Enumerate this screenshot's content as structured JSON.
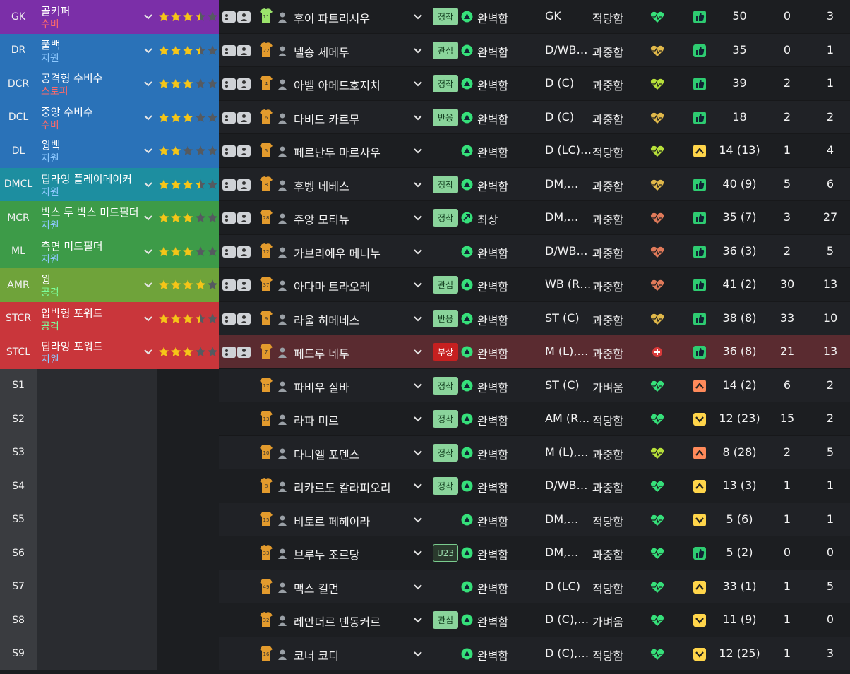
{
  "colors": {
    "gk": "#7b2fa8",
    "def": "#2a72b8",
    "dm": "#1d8ea0",
    "mid": "#3d9b48",
    "wing": "#6fa33a",
    "fwd": "#c9363b",
    "sub_pos": "#3a3c40",
    "sub_role": "#2a2c30",
    "duty_defend": "#ff6a6a",
    "duty_support": "#8ec9ff",
    "duty_attack": "#7cff9a",
    "star": "#f5c518",
    "star_empty": "#555a60",
    "heart_green": "#36e07a",
    "morale_green": "#2ecc71",
    "morale_yellow": "#ffd54a",
    "morale_orange": "#ff8a5a"
  },
  "rows": [
    {
      "pos": "GK",
      "role": "골키퍼",
      "duty": "수비",
      "duty_color": "#ff6a6a",
      "band": "#7b2fa8",
      "stars": 3.5,
      "kit": "11",
      "kit_color": "#9be36b",
      "name": "후이 파트리시우",
      "badge": "정착",
      "badge_type": "settled",
      "cond_icon": "up",
      "cond": "완벽함",
      "ppos": "GK",
      "load": "적당함",
      "heart": "#36e07a",
      "morale": "thumb",
      "morale_color": "#2ecc71",
      "apps": "50",
      "gls": "0",
      "ast": "3"
    },
    {
      "pos": "DR",
      "role": "풀백",
      "duty": "지원",
      "duty_color": "#8ec9ff",
      "band": "#2a72b8",
      "stars": 3.5,
      "kit": "22",
      "kit_color": "#e39b2d",
      "name": "넬송 세메두",
      "badge": "관심",
      "badge_type": "interest",
      "cond_icon": "up",
      "cond": "완벽함",
      "ppos": "D/WB…",
      "load": "과중함",
      "heart": "#e0b84a",
      "morale": "thumb",
      "morale_color": "#2ecc71",
      "apps": "35",
      "gls": "0",
      "ast": "1"
    },
    {
      "pos": "DCR",
      "role": "공격형 수비수",
      "duty": "스토퍼",
      "duty_color": "#ff6a6a",
      "band": "#2a72b8",
      "stars": 3,
      "kit": "4",
      "kit_color": "#e39b2d",
      "name": "아벨 아메드호지치",
      "badge": "정착",
      "badge_type": "settled",
      "cond_icon": "up",
      "cond": "완벽함",
      "ppos": "D (C)",
      "load": "과중함",
      "heart": "#b7e03a",
      "morale": "thumb",
      "morale_color": "#2ecc71",
      "apps": "39",
      "gls": "2",
      "ast": "1"
    },
    {
      "pos": "DCL",
      "role": "중앙 수비수",
      "duty": "수비",
      "duty_color": "#ff6a6a",
      "band": "#2a72b8",
      "stars": 3,
      "kit": "6",
      "kit_color": "#e39b2d",
      "name": "다비드 카르무",
      "badge": "반응",
      "badge_type": "settled",
      "cond_icon": "up",
      "cond": "완벽함",
      "ppos": "D (C)",
      "load": "과중함",
      "heart": "#e0b84a",
      "morale": "thumb",
      "morale_color": "#2ecc71",
      "apps": "18",
      "gls": "2",
      "ast": "2"
    },
    {
      "pos": "DL",
      "role": "윙백",
      "duty": "지원",
      "duty_color": "#8ec9ff",
      "band": "#2a72b8",
      "stars": 2,
      "kit": "5",
      "kit_color": "#e39b2d",
      "name": "페르난두 마르사우",
      "badge": "",
      "badge_type": "",
      "cond_icon": "up",
      "cond": "완벽함",
      "ppos": "D (LC)…",
      "load": "적당함",
      "heart": "#b7e03a",
      "morale": "caret-up",
      "morale_color": "#ffd54a",
      "apps": "14 (13)",
      "gls": "1",
      "ast": "4"
    },
    {
      "pos": "DMCL",
      "role": "딥라잉 플레이메이커",
      "duty": "지원",
      "duty_color": "#8ec9ff",
      "band": "#1d8ea0",
      "stars": 3.5,
      "kit": "8",
      "kit_color": "#e39b2d",
      "name": "후벵 네베스",
      "badge": "정착",
      "badge_type": "settled",
      "cond_icon": "up",
      "cond": "완벽함",
      "ppos": "DM,…",
      "load": "과중함",
      "heart": "#e0b84a",
      "morale": "thumb",
      "morale_color": "#2ecc71",
      "apps": "40 (9)",
      "gls": "5",
      "ast": "6"
    },
    {
      "pos": "MCR",
      "role": "박스 투 박스 미드필더",
      "duty": "지원",
      "duty_color": "#8ec9ff",
      "band": "#3d9b48",
      "stars": 3,
      "kit": "28",
      "kit_color": "#e39b2d",
      "name": "주앙 모티뉴",
      "badge": "정착",
      "badge_type": "settled",
      "cond_icon": "arrow",
      "cond": "최상",
      "ppos": "DM,…",
      "load": "과중함",
      "heart": "#e07a5a",
      "morale": "thumb",
      "morale_color": "#2ecc71",
      "apps": "35 (7)",
      "gls": "3",
      "ast": "27"
    },
    {
      "pos": "ML",
      "role": "측면 미드필더",
      "duty": "지원",
      "duty_color": "#8ec9ff",
      "band": "#3d9b48",
      "stars": 3,
      "kit": "12",
      "kit_color": "#e39b2d",
      "name": "가브리에우 메니누",
      "badge": "",
      "badge_type": "",
      "cond_icon": "up",
      "cond": "완벽함",
      "ppos": "D/WB…",
      "load": "과중함",
      "heart": "#e07a5a",
      "morale": "thumb",
      "morale_color": "#2ecc71",
      "apps": "36 (3)",
      "gls": "2",
      "ast": "5"
    },
    {
      "pos": "AMR",
      "role": "윙",
      "duty": "공격",
      "duty_color": "#7cff9a",
      "band": "#6fa33a",
      "stars": 4,
      "kit": "37",
      "kit_color": "#e39b2d",
      "name": "아다마 트라오레",
      "badge": "관심",
      "badge_type": "interest",
      "cond_icon": "up",
      "cond": "완벽함",
      "ppos": "WB (R…",
      "load": "과중함",
      "heart": "#e07a5a",
      "morale": "thumb",
      "morale_color": "#2ecc71",
      "apps": "41 (2)",
      "gls": "30",
      "ast": "13"
    },
    {
      "pos": "STCR",
      "role": "압박형 포워드",
      "duty": "공격",
      "duty_color": "#7cff9a",
      "band": "#c9363b",
      "stars": 3.5,
      "kit": "9",
      "kit_color": "#e39b2d",
      "name": "라울 히메네스",
      "badge": "반응",
      "badge_type": "settled",
      "cond_icon": "up",
      "cond": "완벽함",
      "ppos": "ST (C)",
      "load": "과중함",
      "heart": "#e0b84a",
      "morale": "thumb",
      "morale_color": "#2ecc71",
      "apps": "38 (8)",
      "gls": "33",
      "ast": "10"
    },
    {
      "pos": "STCL",
      "role": "딥라잉 포워드",
      "duty": "지원",
      "duty_color": "#8ec9ff",
      "band": "#c9363b",
      "stars": 3,
      "kit": "7",
      "kit_color": "#e39b2d",
      "name": "페드루 네투",
      "badge": "부상",
      "badge_type": "inj",
      "cond_icon": "up",
      "cond": "완벽함",
      "ppos": "M (L),…",
      "load": "과중함",
      "heart": "injury",
      "morale": "thumb",
      "morale_color": "#2ecc71",
      "apps": "36 (8)",
      "gls": "21",
      "ast": "13",
      "injured": true
    },
    {
      "pos": "S1",
      "role": "",
      "duty": "",
      "duty_color": "",
      "band": "sub",
      "stars": 0,
      "kit": "17",
      "kit_color": "#e39b2d",
      "name": "파비우 실바",
      "badge": "정착",
      "badge_type": "settled",
      "cond_icon": "up",
      "cond": "완벽함",
      "ppos": "ST (C)",
      "load": "가벼움",
      "heart": "#36e07a",
      "morale": "caret-up",
      "morale_color": "#ff8a5a",
      "apps": "14 (2)",
      "gls": "6",
      "ast": "2"
    },
    {
      "pos": "S2",
      "role": "",
      "duty": "",
      "duty_color": "",
      "band": "sub",
      "stars": 0,
      "kit": "13",
      "kit_color": "#e39b2d",
      "name": "라파 미르",
      "badge": "정착",
      "badge_type": "settled",
      "cond_icon": "up",
      "cond": "완벽함",
      "ppos": "AM (R…",
      "load": "적당함",
      "heart": "#36e07a",
      "morale": "caret-down",
      "morale_color": "#ffd54a",
      "apps": "12 (23)",
      "gls": "15",
      "ast": "2"
    },
    {
      "pos": "S3",
      "role": "",
      "duty": "",
      "duty_color": "",
      "band": "sub",
      "stars": 0,
      "kit": "10",
      "kit_color": "#e39b2d",
      "name": "다니엘 포덴스",
      "badge": "정착",
      "badge_type": "settled",
      "cond_icon": "up",
      "cond": "완벽함",
      "ppos": "M (L),…",
      "load": "과중함",
      "heart": "#b7e03a",
      "morale": "caret-up",
      "morale_color": "#ff8a5a",
      "apps": "8 (28)",
      "gls": "2",
      "ast": "5"
    },
    {
      "pos": "S4",
      "role": "",
      "duty": "",
      "duty_color": "",
      "band": "sub",
      "stars": 0,
      "kit": "8",
      "kit_color": "#e39b2d",
      "name": "리카르도 칼라피오리",
      "badge": "정착",
      "badge_type": "settled",
      "cond_icon": "up",
      "cond": "완벽함",
      "ppos": "D/WB…",
      "load": "과중함",
      "heart": "#36e07a",
      "morale": "caret-up",
      "morale_color": "#ffd54a",
      "apps": "13 (3)",
      "gls": "1",
      "ast": "1"
    },
    {
      "pos": "S5",
      "role": "",
      "duty": "",
      "duty_color": "",
      "band": "sub",
      "stars": 0,
      "kit": "15",
      "kit_color": "#e39b2d",
      "name": "비토르 페헤이라",
      "badge": "",
      "badge_type": "",
      "cond_icon": "up",
      "cond": "완벽함",
      "ppos": "DM,…",
      "load": "적당함",
      "heart": "#36e07a",
      "morale": "caret-down",
      "morale_color": "#ffd54a",
      "apps": "5 (6)",
      "gls": "1",
      "ast": "1"
    },
    {
      "pos": "S6",
      "role": "",
      "duty": "",
      "duty_color": "",
      "band": "sub",
      "stars": 0,
      "kit": "33",
      "kit_color": "#e39b2d",
      "name": "브루누 조르당",
      "badge": "U23",
      "badge_type": "u23",
      "cond_icon": "up",
      "cond": "완벽함",
      "ppos": "DM,…",
      "load": "과중함",
      "heart": "#36e07a",
      "morale": "thumb",
      "morale_color": "#2ecc71",
      "apps": "5 (2)",
      "gls": "0",
      "ast": "0"
    },
    {
      "pos": "S7",
      "role": "",
      "duty": "",
      "duty_color": "",
      "band": "sub",
      "stars": 0,
      "kit": "49",
      "kit_color": "#e39b2d",
      "name": "맥스 킬먼",
      "badge": "",
      "badge_type": "",
      "cond_icon": "up",
      "cond": "완벽함",
      "ppos": "D (LC)",
      "load": "적당함",
      "heart": "#36e07a",
      "morale": "caret-up",
      "morale_color": "#ffd54a",
      "apps": "33 (1)",
      "gls": "1",
      "ast": "5"
    },
    {
      "pos": "S8",
      "role": "",
      "duty": "",
      "duty_color": "",
      "band": "sub",
      "stars": 0,
      "kit": "32",
      "kit_color": "#e39b2d",
      "name": "레안더르 덴동커르",
      "badge": "관심",
      "badge_type": "interest",
      "cond_icon": "up",
      "cond": "완벽함",
      "ppos": "D (C),…",
      "load": "가벼움",
      "heart": "#36e07a",
      "morale": "caret-down",
      "morale_color": "#ffd54a",
      "apps": "11 (9)",
      "gls": "1",
      "ast": "0"
    },
    {
      "pos": "S9",
      "role": "",
      "duty": "",
      "duty_color": "",
      "band": "sub",
      "stars": 0,
      "kit": "16",
      "kit_color": "#e39b2d",
      "name": "코너 코디",
      "badge": "",
      "badge_type": "",
      "cond_icon": "up",
      "cond": "완벽함",
      "ppos": "D (C),…",
      "load": "적당함",
      "heart": "#36e07a",
      "morale": "caret-down",
      "morale_color": "#ffd54a",
      "apps": "12 (25)",
      "gls": "1",
      "ast": "3"
    }
  ]
}
